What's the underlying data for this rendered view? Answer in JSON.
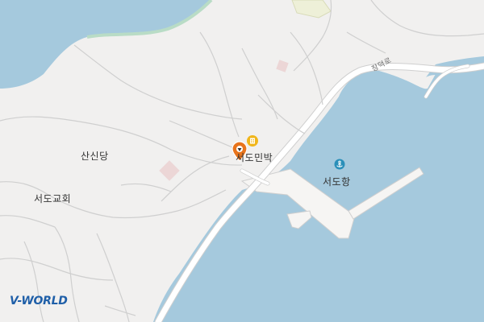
{
  "map": {
    "colors": {
      "land": "#f1f0ef",
      "water": "#a5c9dd",
      "road_fill": "#ffffff",
      "road_edge": "#cfcfcf",
      "building": "#ecd6d6",
      "park": "#eef0d8",
      "green_edge": "#b9dcc6",
      "accent_pin": "#e8741c",
      "hotel_icon": "#f0b61b",
      "harbor_icon": "#2a8fb9"
    },
    "labels": {
      "sansindang": "산신당",
      "church": "서도교회",
      "minbak": "서도민박",
      "harbor": "서도항",
      "road": "장덕로"
    },
    "icons": {
      "poi_pin": "location-pin-icon",
      "lodging": "hotel-icon",
      "harbor": "anchor-icon"
    }
  },
  "branding": {
    "logo_v": "V",
    "logo_rest": "-WORLD"
  }
}
